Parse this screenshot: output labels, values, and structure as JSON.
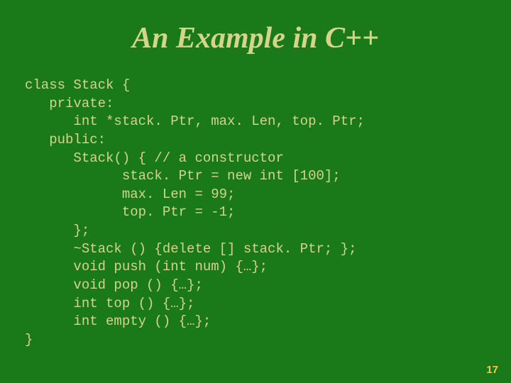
{
  "title": "An Example in C++",
  "code": "class Stack {\n   private:\n      int *stack. Ptr, max. Len, top. Ptr;\n   public:\n      Stack() { // a constructor\n            stack. Ptr = new int [100];\n            max. Len = 99;\n            top. Ptr = -1;\n      };\n      ~Stack () {delete [] stack. Ptr; };\n      void push (int num) {…};\n      void pop () {…};\n      int top () {…};\n      int empty () {…};\n}",
  "page_number": "17"
}
